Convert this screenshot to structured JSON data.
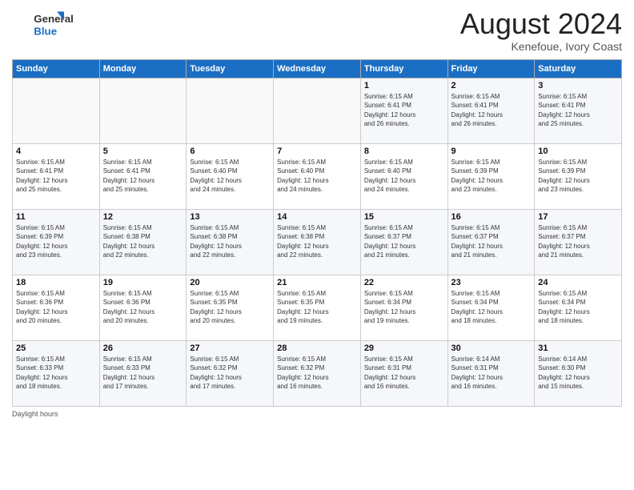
{
  "header": {
    "logo_line1": "General",
    "logo_line2": "Blue",
    "month_title": "August 2024",
    "location": "Kenefoue, Ivory Coast"
  },
  "days_of_week": [
    "Sunday",
    "Monday",
    "Tuesday",
    "Wednesday",
    "Thursday",
    "Friday",
    "Saturday"
  ],
  "weeks": [
    [
      {
        "day": "",
        "info": ""
      },
      {
        "day": "",
        "info": ""
      },
      {
        "day": "",
        "info": ""
      },
      {
        "day": "",
        "info": ""
      },
      {
        "day": "1",
        "info": "Sunrise: 6:15 AM\nSunset: 6:41 PM\nDaylight: 12 hours\nand 26 minutes."
      },
      {
        "day": "2",
        "info": "Sunrise: 6:15 AM\nSunset: 6:41 PM\nDaylight: 12 hours\nand 26 minutes."
      },
      {
        "day": "3",
        "info": "Sunrise: 6:15 AM\nSunset: 6:41 PM\nDaylight: 12 hours\nand 25 minutes."
      }
    ],
    [
      {
        "day": "4",
        "info": "Sunrise: 6:15 AM\nSunset: 6:41 PM\nDaylight: 12 hours\nand 25 minutes."
      },
      {
        "day": "5",
        "info": "Sunrise: 6:15 AM\nSunset: 6:41 PM\nDaylight: 12 hours\nand 25 minutes."
      },
      {
        "day": "6",
        "info": "Sunrise: 6:15 AM\nSunset: 6:40 PM\nDaylight: 12 hours\nand 24 minutes."
      },
      {
        "day": "7",
        "info": "Sunrise: 6:15 AM\nSunset: 6:40 PM\nDaylight: 12 hours\nand 24 minutes."
      },
      {
        "day": "8",
        "info": "Sunrise: 6:15 AM\nSunset: 6:40 PM\nDaylight: 12 hours\nand 24 minutes."
      },
      {
        "day": "9",
        "info": "Sunrise: 6:15 AM\nSunset: 6:39 PM\nDaylight: 12 hours\nand 23 minutes."
      },
      {
        "day": "10",
        "info": "Sunrise: 6:15 AM\nSunset: 6:39 PM\nDaylight: 12 hours\nand 23 minutes."
      }
    ],
    [
      {
        "day": "11",
        "info": "Sunrise: 6:15 AM\nSunset: 6:39 PM\nDaylight: 12 hours\nand 23 minutes."
      },
      {
        "day": "12",
        "info": "Sunrise: 6:15 AM\nSunset: 6:38 PM\nDaylight: 12 hours\nand 22 minutes."
      },
      {
        "day": "13",
        "info": "Sunrise: 6:15 AM\nSunset: 6:38 PM\nDaylight: 12 hours\nand 22 minutes."
      },
      {
        "day": "14",
        "info": "Sunrise: 6:15 AM\nSunset: 6:38 PM\nDaylight: 12 hours\nand 22 minutes."
      },
      {
        "day": "15",
        "info": "Sunrise: 6:15 AM\nSunset: 6:37 PM\nDaylight: 12 hours\nand 21 minutes."
      },
      {
        "day": "16",
        "info": "Sunrise: 6:15 AM\nSunset: 6:37 PM\nDaylight: 12 hours\nand 21 minutes."
      },
      {
        "day": "17",
        "info": "Sunrise: 6:15 AM\nSunset: 6:37 PM\nDaylight: 12 hours\nand 21 minutes."
      }
    ],
    [
      {
        "day": "18",
        "info": "Sunrise: 6:15 AM\nSunset: 6:36 PM\nDaylight: 12 hours\nand 20 minutes."
      },
      {
        "day": "19",
        "info": "Sunrise: 6:15 AM\nSunset: 6:36 PM\nDaylight: 12 hours\nand 20 minutes."
      },
      {
        "day": "20",
        "info": "Sunrise: 6:15 AM\nSunset: 6:35 PM\nDaylight: 12 hours\nand 20 minutes."
      },
      {
        "day": "21",
        "info": "Sunrise: 6:15 AM\nSunset: 6:35 PM\nDaylight: 12 hours\nand 19 minutes."
      },
      {
        "day": "22",
        "info": "Sunrise: 6:15 AM\nSunset: 6:34 PM\nDaylight: 12 hours\nand 19 minutes."
      },
      {
        "day": "23",
        "info": "Sunrise: 6:15 AM\nSunset: 6:34 PM\nDaylight: 12 hours\nand 18 minutes."
      },
      {
        "day": "24",
        "info": "Sunrise: 6:15 AM\nSunset: 6:34 PM\nDaylight: 12 hours\nand 18 minutes."
      }
    ],
    [
      {
        "day": "25",
        "info": "Sunrise: 6:15 AM\nSunset: 6:33 PM\nDaylight: 12 hours\nand 18 minutes."
      },
      {
        "day": "26",
        "info": "Sunrise: 6:15 AM\nSunset: 6:33 PM\nDaylight: 12 hours\nand 17 minutes."
      },
      {
        "day": "27",
        "info": "Sunrise: 6:15 AM\nSunset: 6:32 PM\nDaylight: 12 hours\nand 17 minutes."
      },
      {
        "day": "28",
        "info": "Sunrise: 6:15 AM\nSunset: 6:32 PM\nDaylight: 12 hours\nand 16 minutes."
      },
      {
        "day": "29",
        "info": "Sunrise: 6:15 AM\nSunset: 6:31 PM\nDaylight: 12 hours\nand 16 minutes."
      },
      {
        "day": "30",
        "info": "Sunrise: 6:14 AM\nSunset: 6:31 PM\nDaylight: 12 hours\nand 16 minutes."
      },
      {
        "day": "31",
        "info": "Sunrise: 6:14 AM\nSunset: 6:30 PM\nDaylight: 12 hours\nand 15 minutes."
      }
    ]
  ],
  "footer": {
    "note": "Daylight hours"
  }
}
